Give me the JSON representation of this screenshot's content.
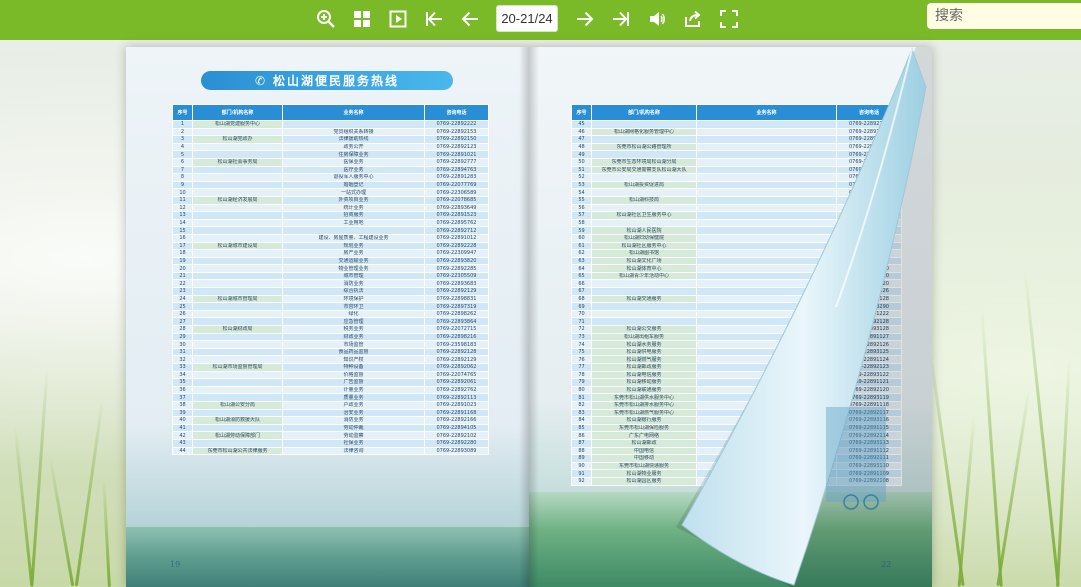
{
  "toolbar": {
    "zoom_icon": "zoom-in-icon",
    "thumbnails_icon": "thumbnails-icon",
    "slideshow_icon": "play-icon",
    "first_icon": "first-page-icon",
    "prev_icon": "previous-page-icon",
    "page_indicator": "20-21/24",
    "next_icon": "next-page-icon",
    "last_icon": "last-page-icon",
    "sound_icon": "sound-icon",
    "share_icon": "share-icon",
    "fullscreen_icon": "fullscreen-icon",
    "search_placeholder": "搜索",
    "bar_color": "#7ab928"
  },
  "left_page": {
    "title": "松山湖便民服务热线",
    "page_number": "19",
    "headers": [
      "序号",
      "部门/机构名称",
      "业务名称",
      "咨询电话"
    ],
    "rows": [
      [
        "1",
        "松山湖党建服务中心",
        "",
        "0769-22892222"
      ],
      [
        "2",
        "",
        "党员组织关系转接",
        "0769-22892153"
      ],
      [
        "3",
        "松山湖党政办",
        "法律援助热线",
        "0769-22892150"
      ],
      [
        "4",
        "",
        "政务公开",
        "0769-22892123"
      ],
      [
        "5",
        "",
        "住房保障业务",
        "0769-22891021"
      ],
      [
        "6",
        "松山湖社会事务局",
        "医保业务",
        "0769-22892777"
      ],
      [
        "7",
        "",
        "医疗业务",
        "0769-22894763"
      ],
      [
        "8",
        "",
        "退役军人服务中心",
        "0769-22891283"
      ],
      [
        "9",
        "",
        "婚姻登记",
        "0769-22077769"
      ],
      [
        "10",
        "",
        "一站式办理",
        "0769-22306589"
      ],
      [
        "11",
        "松山湖经济发展局",
        "外资项目业务",
        "0769-22078685"
      ],
      [
        "12",
        "",
        "统计业务",
        "0769-22893649"
      ],
      [
        "13",
        "",
        "招商服务",
        "0769-22891523"
      ],
      [
        "14",
        "",
        "工业用地",
        "0769-22895762"
      ],
      [
        "15",
        "",
        "",
        "0769-22892712"
      ],
      [
        "16",
        "",
        "建设、房屋质量、工程建设业务",
        "0769-22891012"
      ],
      [
        "17",
        "松山湖城市建设局",
        "规划业务",
        "0769-22892228"
      ],
      [
        "18",
        "",
        "房产业务",
        "0769-22309947"
      ],
      [
        "19",
        "",
        "交通运输业务",
        "0769-22893820"
      ],
      [
        "20",
        "",
        "物业管理业务",
        "0769-22892285"
      ],
      [
        "21",
        "",
        "城市管理",
        "0769-22305509"
      ],
      [
        "22",
        "",
        "消防业务",
        "0769-22893683"
      ],
      [
        "23",
        "",
        "综合执法",
        "0769-22892129"
      ],
      [
        "24",
        "松山湖城市管理局",
        "环境保护",
        "0769-22898831"
      ],
      [
        "25",
        "",
        "市容环卫",
        "0769-22897319"
      ],
      [
        "26",
        "",
        "绿化",
        "0769-22898262"
      ],
      [
        "27",
        "",
        "应急管理",
        "0769-22893864"
      ],
      [
        "28",
        "松山湖财政局",
        "税务业务",
        "0769-22072715"
      ],
      [
        "29",
        "",
        "财政业务",
        "0769-22898216"
      ],
      [
        "30",
        "",
        "市场监管",
        "0769-23598183"
      ],
      [
        "31",
        "",
        "食品药品监督",
        "0769-22892128"
      ],
      [
        "32",
        "",
        "知识产权",
        "0769-22892129"
      ],
      [
        "33",
        "松山湖市场监督管理局",
        "特种设备",
        "0769-22892062"
      ],
      [
        "34",
        "",
        "价格监督",
        "0769-22074765"
      ],
      [
        "35",
        "",
        "广告监督",
        "0769-22892061"
      ],
      [
        "36",
        "",
        "计量业务",
        "0769-22892762"
      ],
      [
        "37",
        "",
        "质量业务",
        "0769-22892113"
      ],
      [
        "38",
        "松山湖公安分局",
        "户政业务",
        "0769-22891023"
      ],
      [
        "39",
        "",
        "治安业务",
        "0769-22891168"
      ],
      [
        "40",
        "松山湖消防救援大队",
        "消防业务",
        "0769-22892166"
      ],
      [
        "41",
        "",
        "劳动仲裁",
        "0769-22894105"
      ],
      [
        "42",
        "松山湖劳动保障部门",
        "劳动监察",
        "0769-22892102"
      ],
      [
        "43",
        "",
        "社保业务",
        "0769-22892280"
      ],
      [
        "44",
        "东莞市松山湖公共法律服务",
        "法律咨询",
        "0769-22893089"
      ]
    ]
  },
  "right_page": {
    "page_number": "22",
    "headers": [
      "序号",
      "部门/机构名称",
      "业务名称",
      "咨询电话"
    ],
    "rows": [
      [
        "45",
        "",
        "",
        "0769-22892760"
      ],
      [
        "46",
        "松山湖网格化服务管理中心",
        "",
        "0769-22891270"
      ],
      [
        "47",
        "",
        "",
        "0769-22892110"
      ],
      [
        "48",
        "东莞市松山湖公路管理所",
        "",
        "0769-22891125"
      ],
      [
        "49",
        "",
        "",
        "0769-22892266"
      ],
      [
        "50",
        "东莞市生态环境局松山湖分局",
        "",
        "0769-22893311"
      ],
      [
        "51",
        "东莞市公安局交通警察支队松山湖大队",
        "",
        "0769-22891125"
      ],
      [
        "52",
        "",
        "",
        "0769-22892121"
      ],
      [
        "53",
        "松山湖投资促进局",
        "",
        "0769-22892282"
      ],
      [
        "54",
        "",
        "",
        "0769-22893820"
      ],
      [
        "55",
        "松山湖科技局",
        "",
        "0769-22891128"
      ],
      [
        "56",
        "",
        "",
        "0769-22892129"
      ],
      [
        "57",
        "松山湖社区卫生服务中心",
        "",
        "0769-22893382"
      ],
      [
        "58",
        "",
        "",
        "0769-22891162"
      ],
      [
        "59",
        "松山湖人民医院",
        "",
        "0769-22892120"
      ],
      [
        "60",
        "松山湖妇幼保健院",
        "",
        "0769-22893128"
      ],
      [
        "61",
        "松山湖社区服务中心",
        "",
        "0769-22891210"
      ],
      [
        "62",
        "松山湖图书馆",
        "",
        "0769-22892230"
      ],
      [
        "63",
        "松山湖文化广场",
        "",
        "0769-22893130"
      ],
      [
        "64",
        "松山湖体育中心",
        "",
        "0769-22891250"
      ],
      [
        "65",
        "松山湖青少年活动中心",
        "",
        "0769-22892120"
      ],
      [
        "66",
        "",
        "",
        "0769-22893120"
      ],
      [
        "67",
        "",
        "",
        "0769-22891126"
      ],
      [
        "68",
        "松山湖交通服务",
        "",
        "0769-22892128"
      ],
      [
        "69",
        "",
        "",
        "0769-22893290"
      ],
      [
        "70",
        "",
        "",
        "0769-22891222"
      ],
      [
        "71",
        "",
        "",
        "0769-22892128"
      ],
      [
        "72",
        "松山湖公交服务",
        "",
        "0769-22893128"
      ],
      [
        "73",
        "松山湖出租车服务",
        "",
        "0769-22891127"
      ],
      [
        "74",
        "松山湖水务服务",
        "",
        "0769-22892126"
      ],
      [
        "75",
        "松山湖供电服务",
        "",
        "0769-22893125"
      ],
      [
        "76",
        "松山湖燃气服务",
        "",
        "0769-22891124"
      ],
      [
        "77",
        "松山湖邮政服务",
        "",
        "0769-22892123"
      ],
      [
        "78",
        "松山湖电信服务",
        "",
        "0769-22893122"
      ],
      [
        "79",
        "松山湖移动服务",
        "",
        "0769-22891121"
      ],
      [
        "80",
        "松山湖联通服务",
        "",
        "0769-22892120"
      ],
      [
        "81",
        "东莞市松山湖供水服务中心",
        "",
        "0769-22893119"
      ],
      [
        "82",
        "东莞市松山湖排水服务中心",
        "",
        "0769-22891118"
      ],
      [
        "83",
        "东莞市松山湖燃气服务中心",
        "",
        "0769-22892117"
      ],
      [
        "84",
        "松山湖银行服务",
        "",
        "0769-22893116"
      ],
      [
        "85",
        "东莞市松山湖保险服务",
        "",
        "0769-22891115"
      ],
      [
        "86",
        "广东广电网络",
        "",
        "0769-22892114"
      ],
      [
        "87",
        "松山湖邮政",
        "",
        "0769-22893113"
      ],
      [
        "88",
        "中国电信",
        "",
        "0769-22891112"
      ],
      [
        "89",
        "中国移动",
        "",
        "0769-22892111"
      ],
      [
        "90",
        "东莞市松山湖快递服务",
        "",
        "0769-22893110"
      ],
      [
        "91",
        "松山湖物业服务",
        "",
        "0769-22891109"
      ],
      [
        "92",
        "松山湖园区服务",
        "",
        "0769-22892108"
      ]
    ]
  }
}
